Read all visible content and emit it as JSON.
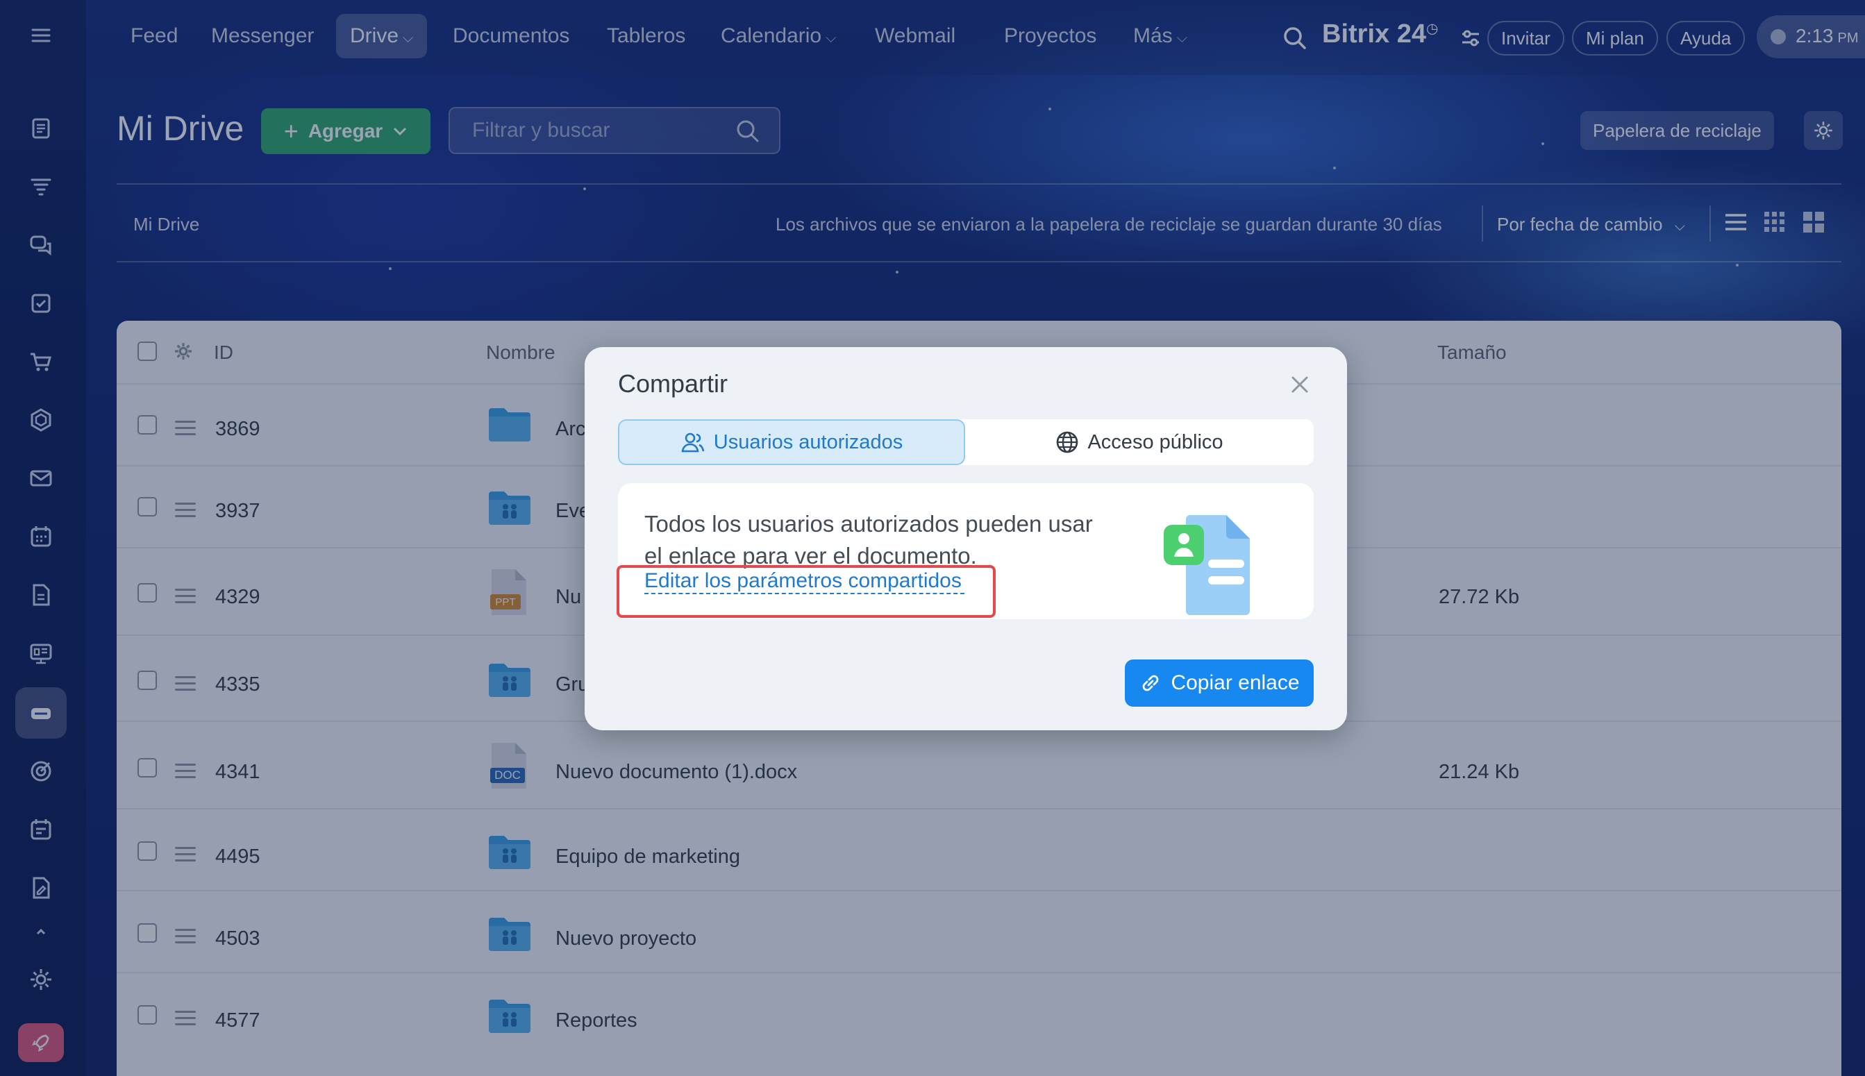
{
  "nav": {
    "items": [
      {
        "label": "Feed"
      },
      {
        "label": "Messenger"
      },
      {
        "label": "Drive"
      },
      {
        "label": "Documentos"
      },
      {
        "label": "Tableros"
      },
      {
        "label": "Calendario"
      },
      {
        "label": "Webmail"
      },
      {
        "label": "Proyectos"
      },
      {
        "label": "Más"
      }
    ],
    "brand": "Bitrix 24",
    "brand_mark": "◷",
    "invite": "Invitar",
    "plan": "Mi plan",
    "help": "Ayuda",
    "time": "2:13",
    "ampm": "PM"
  },
  "page": {
    "title": "Mi Drive",
    "add_button": "Agregar",
    "search_placeholder": "Filtrar y buscar",
    "trash_button": "Papelera de reciclaje",
    "breadcrumb": "Mi Drive",
    "retention_info": "Los archivos que se enviaron a la papelera de reciclaje se guardan durante 30 días",
    "sort_label": "Por fecha de cambio"
  },
  "table": {
    "headers": {
      "id": "ID",
      "name": "Nombre",
      "size": "Tamaño"
    },
    "rows": [
      {
        "id": "3869",
        "name": "Arc",
        "size": "",
        "icon": "folder-icon"
      },
      {
        "id": "3937",
        "name": "Eve",
        "size": "",
        "icon": "shared-folder-icon"
      },
      {
        "id": "4329",
        "name": "Nu",
        "size": "27.72 Kb",
        "icon": "ppt-file-icon",
        "badge": "PPT"
      },
      {
        "id": "4335",
        "name": "Gru",
        "size": "",
        "icon": "shared-folder-icon"
      },
      {
        "id": "4341",
        "name": "Nuevo documento (1).docx",
        "size": "21.24 Kb",
        "icon": "doc-file-icon",
        "badge": "DOC"
      },
      {
        "id": "4495",
        "name": "Equipo de marketing",
        "size": "",
        "icon": "shared-folder-icon"
      },
      {
        "id": "4503",
        "name": "Nuevo proyecto",
        "size": "",
        "icon": "shared-folder-icon"
      },
      {
        "id": "4577",
        "name": "Reportes",
        "size": "",
        "icon": "shared-folder-icon"
      }
    ]
  },
  "modal": {
    "title": "Compartir",
    "tab_authorized": "Usuarios autorizados",
    "tab_public": "Acceso público",
    "info_text": "Todos los usuarios autorizados pueden usar el enlace para ver el documento.",
    "edit_link": "Editar los parámetros compartidos",
    "copy_button": "Copiar enlace"
  },
  "colors": {
    "accent_blue": "#1688f0",
    "add_green": "#2fa76a",
    "highlight_red": "#e5484d"
  }
}
